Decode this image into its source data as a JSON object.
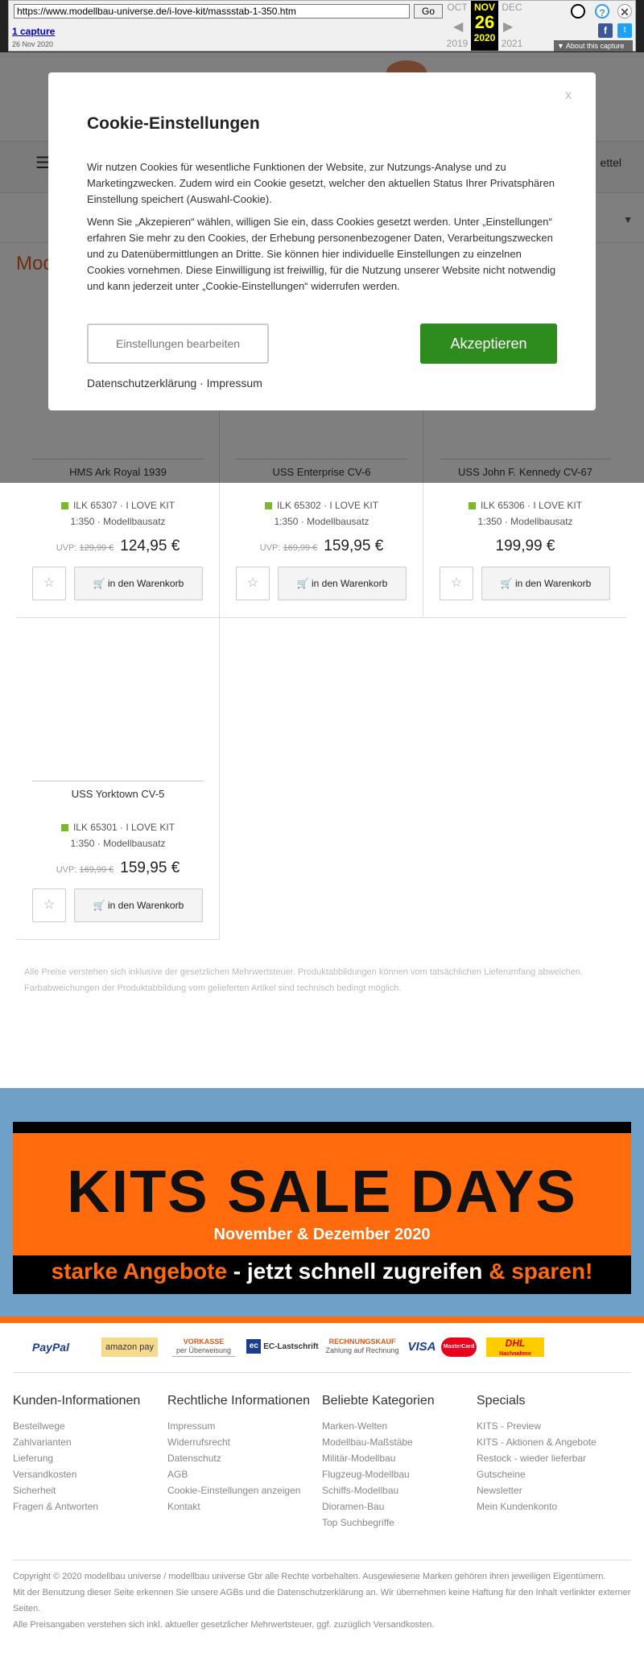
{
  "wayback": {
    "url": "https://www.modellbau-universe.de/i-love-kit/massstab-1-350.htm",
    "go": "Go",
    "captures": "1 capture",
    "capture_date": "26 Nov 2020",
    "prev_month": "OCT",
    "cur_month": "NOV",
    "next_month": "DEC",
    "cur_day": "26",
    "prev_year": "2019",
    "cur_year": "2020",
    "next_year": "2021",
    "about": "About this capture"
  },
  "header": {
    "merkzettel": "ettel",
    "page_title": "Mod"
  },
  "products": [
    {
      "name": "HMS Ark Royal 1939",
      "sku": "ILK 65307 · I LOVE KIT",
      "scale": "1:350 · Modellbausatz",
      "uvp_label": "UVP:",
      "uvp": "129,99 €",
      "price": "124,95 €",
      "cart": "in den Warenkorb"
    },
    {
      "name": "USS Enterprise CV-6",
      "sku": "ILK 65302 · I LOVE KIT",
      "scale": "1:350 · Modellbausatz",
      "uvp_label": "UVP:",
      "uvp": "169,99 €",
      "price": "159,95 €",
      "cart": "in den Warenkorb"
    },
    {
      "name": "USS John F. Kennedy CV-67",
      "sku": "ILK 65306 · I LOVE KIT",
      "scale": "1:350 · Modellbausatz",
      "uvp_label": "",
      "uvp": "",
      "price": "199,99 €",
      "cart": "in den Warenkorb"
    },
    {
      "name": "USS Yorktown CV-5",
      "sku": "ILK 65301 · I LOVE KIT",
      "scale": "1:350 · Modellbausatz",
      "uvp_label": "UVP:",
      "uvp": "169,99 €",
      "price": "159,95 €",
      "cart": "in den Warenkorb"
    }
  ],
  "disclaimer": "Alle Preise verstehen sich inklusive der gesetzlichen Mehrwertsteuer. Produktabbildungen können vom tatsächlichen Lieferumfang abweichen. Farbabweichungen der Produktabbildung vom gelieferten Artikel sind technisch bedingt möglich.",
  "banner": {
    "title": "KITS SALE DAYS",
    "subtitle": "November & Dezember 2020",
    "tag_a": "starke Angebote",
    "tag_b": " - jetzt schnell zugreifen ",
    "tag_c": "& sparen!"
  },
  "payment": {
    "paypal": "PayPal",
    "amazon": "amazon pay",
    "vorkasse": "VORKASSE",
    "vorkasse_sub": "per Überweisung",
    "ec": "EC-Lastschrift",
    "rechnung": "RECHNUNGSKAUF",
    "rechnung_sub": "Zahlung auf Rechnung",
    "visa": "VISA",
    "mastercard": "MasterCard",
    "dhl": "DHL",
    "dhl_sub": "Nachnahme"
  },
  "footer": {
    "cols": [
      {
        "title": "Kunden-Informationen",
        "links": [
          "Bestellwege",
          "Zahlvarianten",
          "Lieferung",
          "Versandkosten",
          "Sicherheit",
          "Fragen & Antworten"
        ]
      },
      {
        "title": "Rechtliche Informationen",
        "links": [
          "Impressum",
          "Widerrufsrecht",
          "Datenschutz",
          "AGB",
          "Cookie-Einstellungen anzeigen",
          "Kontakt"
        ]
      },
      {
        "title": "Beliebte Kategorien",
        "links": [
          "Marken-Welten",
          "Modellbau-Maßstäbe",
          "Militär-Modellbau",
          "Flugzeug-Modellbau",
          "Schiffs-Modellbau",
          "Dioramen-Bau",
          "Top Suchbegriffe"
        ]
      },
      {
        "title": "Specials",
        "links": [
          "KITS - Preview",
          "KITS - Aktionen & Angebote",
          "Restock - wieder lieferbar",
          "Gutscheine",
          "Newsletter",
          "Mein Kundenkonto"
        ]
      }
    ],
    "copy1": "Copyright © 2020 modellbau universe / modellbau universe Gbr alle Rechte vorbehalten. Ausgewiesene Marken gehören ihren jeweiligen Eigentümern.",
    "copy2": "Mit der Benutzung dieser Seite erkennen Sie unsere AGBs und die Datenschutzerklärung an. Wir übernehmen keine Haftung für den Inhalt verlinkter externer Seiten.",
    "copy3": "Alle Preisangaben verstehen sich inkl. aktueller gesetzlicher Mehrwertsteuer, ggf. zuzüglich Versandkosten."
  },
  "cookie": {
    "close": "x",
    "title": "Cookie-Einstellungen",
    "p1": "Wir nutzen Cookies für wesentliche Funktionen der Website, zur Nutzungs-Analyse und zu Marketingzwecken. Zudem wird ein Cookie gesetzt, welcher den aktuellen Status Ihrer Privatsphären Einstellung speichert (Auswahl-Cookie).",
    "p2": "Wenn Sie „Akzepieren“ wählen, willigen Sie ein, dass Cookies gesetzt werden. Unter „Einstellungen“ erfahren Sie mehr zu den Cookies, der Erhebung personenbezogener Daten, Verarbeitungszwecken und zu Datenübermittlungen an Dritte. Sie können hier individuelle Einstellungen zu einzelnen Cookies vornehmen. Diese Einwilligung ist freiwillig, für die Nutzung unserer Website nicht notwendig und kann jederzeit unter „Cookie-Einstellungen“ widerrufen werden.",
    "edit": "Einstellungen bearbeiten",
    "accept": "Akzeptieren",
    "privacy": "Datenschutzerklärung",
    "sep": " · ",
    "imprint": "Impressum"
  }
}
